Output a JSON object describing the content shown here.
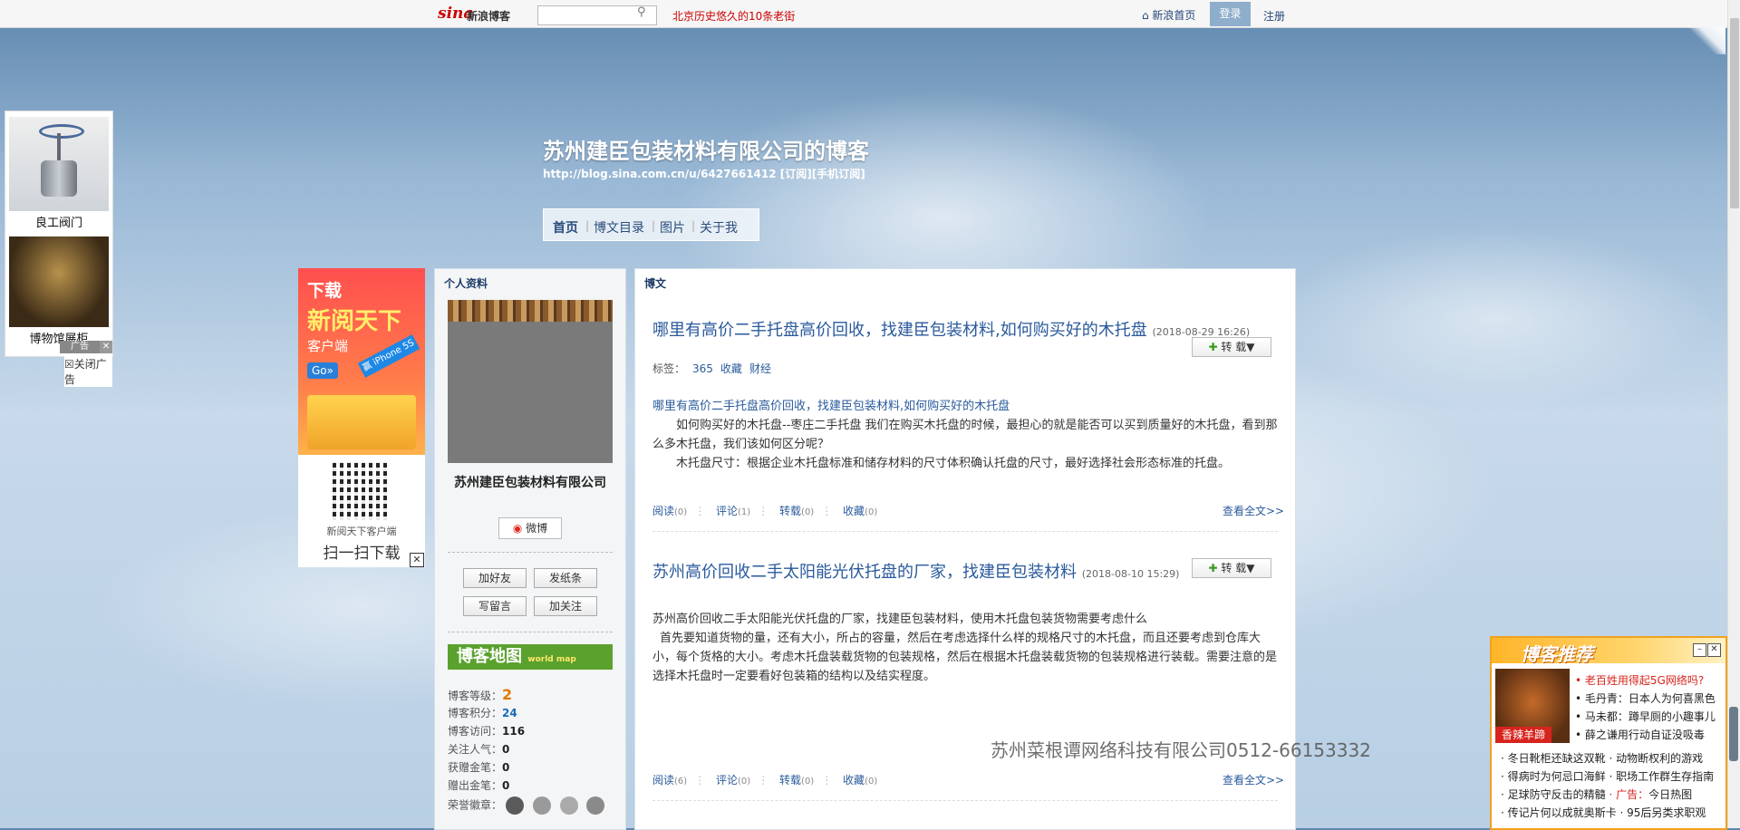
{
  "topbar": {
    "logo": "sina",
    "logo_sub": "新浪博客",
    "search_placeholder": "",
    "hot_link": "北京历史悠久的10条老街",
    "home_link": "⌂ 新浪首页",
    "login": "登录",
    "register": "注册"
  },
  "header": {
    "title": "苏州建臣包装材料有限公司的博客",
    "url": "http://blog.sina.com.cn/u/6427661412 [订阅][手机订阅]",
    "nav": [
      "首页",
      "博文目录",
      "图片",
      "关于我"
    ]
  },
  "float_ad": {
    "label1": "良工阀门",
    "label2": "博物馆展柜",
    "ad_tag": "广告",
    "close_label": "☒关闭广告"
  },
  "download_ad": {
    "line1": "下载",
    "line2": "新阅天下",
    "line3": "客户端",
    "go": "Go»",
    "phone_tag": "赢 iPhone 5S",
    "caption_small": "新阅天下客户端",
    "caption_big": "扫一扫下载"
  },
  "profile": {
    "title": "个人资料",
    "name": "苏州建臣包装材料有限公司",
    "weibo": "微博",
    "buttons": [
      "加好友",
      "发纸条",
      "写留言",
      "加关注"
    ],
    "map_label": "博客地图",
    "map_sub": "world map",
    "stats": [
      {
        "label": "博客等级：",
        "value": "2"
      },
      {
        "label": "博客积分：",
        "value": "24"
      },
      {
        "label": "博客访问：",
        "value": "116"
      },
      {
        "label": "关注人气：",
        "value": "0"
      },
      {
        "label": "获赠金笔：",
        "value": "0"
      },
      {
        "label": "赠出金笔：",
        "value": "0"
      }
    ],
    "medals_label": "荣誉徽章："
  },
  "posts": {
    "title": "博文",
    "repost_label": "转 载▼",
    "read_more": "查看全文>>",
    "tags_label": "标签：",
    "items": [
      {
        "headline": "哪里有高价二手托盘高价回收，找建臣包装材料,如何购买好的木托盘",
        "date": "(2018-08-29 16:26)",
        "tags": [
          "365",
          "收藏",
          "财经"
        ],
        "sub": "哪里有高价二手托盘高价回收，找建臣包装材料,如何购买好的木托盘",
        "p1": "如何购买好的木托盘--枣庄二手托盘 我们在购买木托盘的时候，最担心的就是能否可以买到质量好的木托盘，看到那么多木托盘，我们该如何区分呢？",
        "p2": "木托盘尺寸：根据企业木托盘标准和储存材料的尺寸体积确认托盘的尺寸，最好选择社会形态标准的托盘。",
        "meta": {
          "read": "阅读",
          "read_c": "(0)",
          "comment": "评论",
          "comment_c": "(1)",
          "repost": "转载",
          "repost_c": "(0)",
          "fav": "收藏",
          "fav_c": "(0)"
        }
      },
      {
        "headline": "苏州高价回收二手太阳能光伏托盘的厂家，找建臣包装材料",
        "date": "(2018-08-10 15:29)",
        "p1": "苏州高价回收二手太阳能光伏托盘的厂家，找建臣包装材料，使用木托盘包装货物需要考虑什么",
        "p2": "首先要知道货物的量，还有大小，所占的容量，然后在考虑选择什么样的规格尺寸的木托盘，而且还要考虑到仓库大小，每个货格的大小。考虑木托盘装载货物的包装规格，然后在根据木托盘装载货物的包装规格进行装载。需要注意的是选择木托盘时一定要看好包装箱的结构以及结实程度。",
        "meta": {
          "read": "阅读",
          "read_c": "(6)",
          "comment": "评论",
          "comment_c": "(0)",
          "repost": "转载",
          "repost_c": "(0)",
          "fav": "收藏",
          "fav_c": "(0)"
        }
      }
    ]
  },
  "watermark": "苏州菜根谭网络科技有限公司0512-66153332",
  "recommend": {
    "title": "博客推荐",
    "img_label": "香辣羊蹄",
    "lines": [
      "• 老百姓用得起5G网络吗?",
      "• 毛丹青：日本人为何喜黑色",
      "• 马未都：蹲早厕的小趣事儿",
      "• 薛之谦用行动自证没吸毒"
    ],
    "rows": [
      "· 冬日靴柜还缺这双靴 · 动物断权利的游戏",
      "· 得病时为何忌口海鲜 · 职场工作群生存指南",
      "· 足球防守反击的精髓",
      "· 传记片何以成就奥斯卡 · 95后另类求职观"
    ],
    "ad_label": "· 广告：",
    "ad_text": "今日热图"
  }
}
